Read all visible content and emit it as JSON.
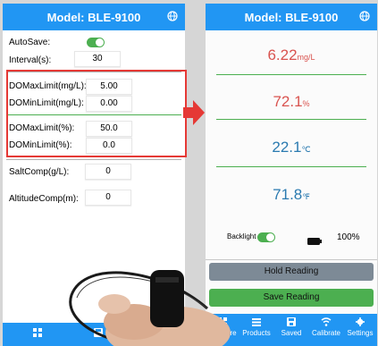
{
  "left_screen": {
    "title": "Model: BLE-9100",
    "autosave_label": "AutoSave:",
    "interval_label": "Interval(s):",
    "interval_value": "30",
    "do_max_mgl_label": "DOMaxLimit(mg/L):",
    "do_max_mgl_value": "5.00",
    "do_min_mgl_label": "DOMinLimit(mg/L):",
    "do_min_mgl_value": "0.00",
    "do_max_pct_label": "DOMaxLimit(%):",
    "do_max_pct_value": "50.0",
    "do_min_pct_label": "DOMinLimit(%):",
    "do_min_pct_value": "0.0",
    "salt_label": "SaltComp(g/L):",
    "salt_value": "0",
    "altitude_label": "AltitudeComp(m):",
    "altitude_value": "0"
  },
  "right_screen": {
    "title": "Model: BLE-9100",
    "do_mgl": {
      "value": "6.22",
      "unit": "mg/L"
    },
    "do_pct": {
      "value": "72.1",
      "unit": "%"
    },
    "temp_c": {
      "value": "22.1",
      "unit": "℃"
    },
    "temp_f": {
      "value": "71.8",
      "unit": "℉"
    },
    "backlight_label": "Backlight",
    "battery_text": "100%",
    "hold_label": "Hold Reading",
    "save_label": "Save Reading",
    "nav": [
      "Measure",
      "Products",
      "Saved",
      "Calibrate",
      "Settings"
    ]
  },
  "colors": {
    "header_blue": "#2196f3",
    "reading_red": "#d9534f",
    "reading_blue": "#2a7ab0",
    "toggle_green": "#4caf50",
    "highlight_red": "#e53935",
    "divider_green": "#4caf50",
    "hold_button_grey": "#7d8a96",
    "save_button_green": "#4caf50"
  }
}
